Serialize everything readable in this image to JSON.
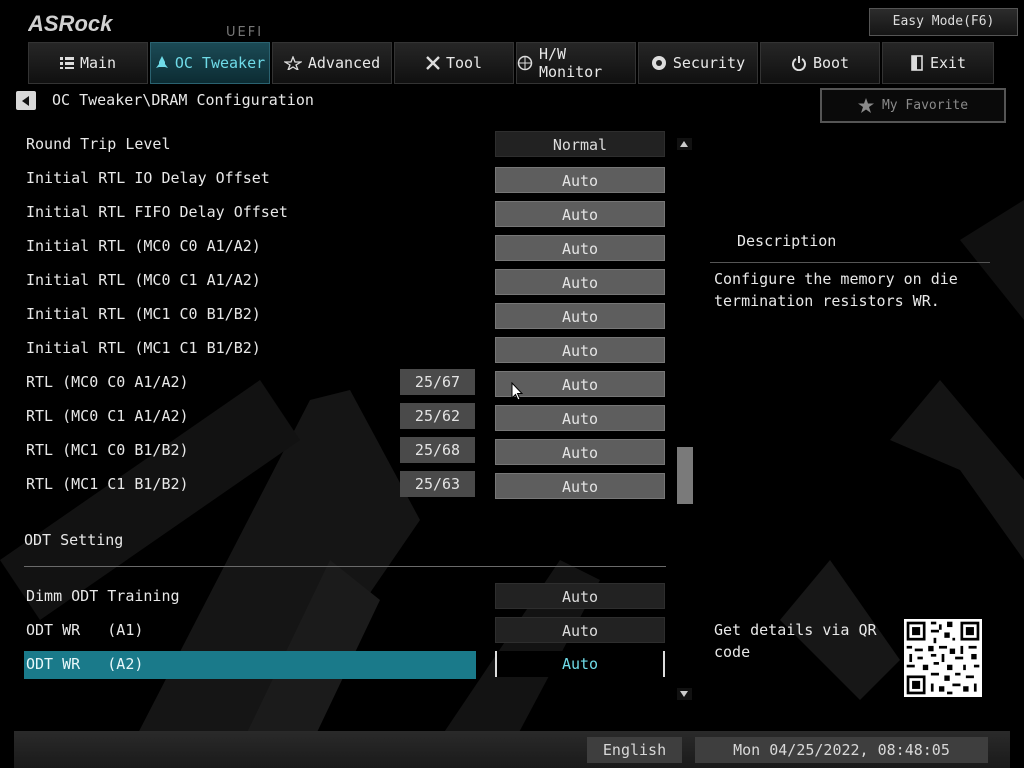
{
  "brand": {
    "logo": "ASRock",
    "sub": "UEFI"
  },
  "easy_mode": "Easy Mode(F6)",
  "tabs": [
    {
      "label": "Main",
      "icon": "list-icon"
    },
    {
      "label": "OC Tweaker",
      "icon": "rocket-icon",
      "active": true
    },
    {
      "label": "Advanced",
      "icon": "star-icon"
    },
    {
      "label": "Tool",
      "icon": "tools-icon"
    },
    {
      "label": "H/W Monitor",
      "icon": "monitor-icon"
    },
    {
      "label": "Security",
      "icon": "shield-icon"
    },
    {
      "label": "Boot",
      "icon": "power-icon"
    },
    {
      "label": "Exit",
      "icon": "exit-icon"
    }
  ],
  "breadcrumb": "OC Tweaker\\DRAM Configuration",
  "favorite": "My Favorite",
  "settings": [
    {
      "label": "Round Trip Level",
      "value": "Normal"
    },
    {
      "label": "Initial RTL IO Delay Offset",
      "value": "Auto"
    },
    {
      "label": "Initial RTL FIFO Delay Offset",
      "value": "Auto"
    },
    {
      "label": "Initial RTL (MC0 C0 A1/A2)",
      "value": "Auto"
    },
    {
      "label": "Initial RTL (MC0 C1 A1/A2)",
      "value": "Auto"
    },
    {
      "label": "Initial RTL (MC1 C0 B1/B2)",
      "value": "Auto"
    },
    {
      "label": "Initial RTL (MC1 C1 B1/B2)",
      "value": "Auto"
    },
    {
      "label": "RTL (MC0 C0 A1/A2)",
      "current": "25/67",
      "value": "Auto"
    },
    {
      "label": "RTL (MC0 C1 A1/A2)",
      "current": "25/62",
      "value": "Auto"
    },
    {
      "label": "RTL (MC1 C0 B1/B2)",
      "current": "25/68",
      "value": "Auto"
    },
    {
      "label": "RTL (MC1 C1 B1/B2)",
      "current": "25/63",
      "value": "Auto"
    }
  ],
  "odt_section": "ODT Setting",
  "odt_settings": [
    {
      "label": "Dimm ODT Training",
      "value": "Auto"
    },
    {
      "label": "ODT WR   (A1)",
      "value": "Auto"
    },
    {
      "label": "ODT WR   (A2)",
      "value": "Auto",
      "selected": true
    }
  ],
  "description": {
    "title": "Description",
    "text": "Configure the memory on die termination resistors WR."
  },
  "qr_hint": "Get details via QR code",
  "footer": {
    "language": "English",
    "datetime": "Mon 04/25/2022, 08:48:05"
  },
  "colors": {
    "accent": "#1a7a8a",
    "accent_text": "#6fdbe8",
    "background": "#000000"
  }
}
